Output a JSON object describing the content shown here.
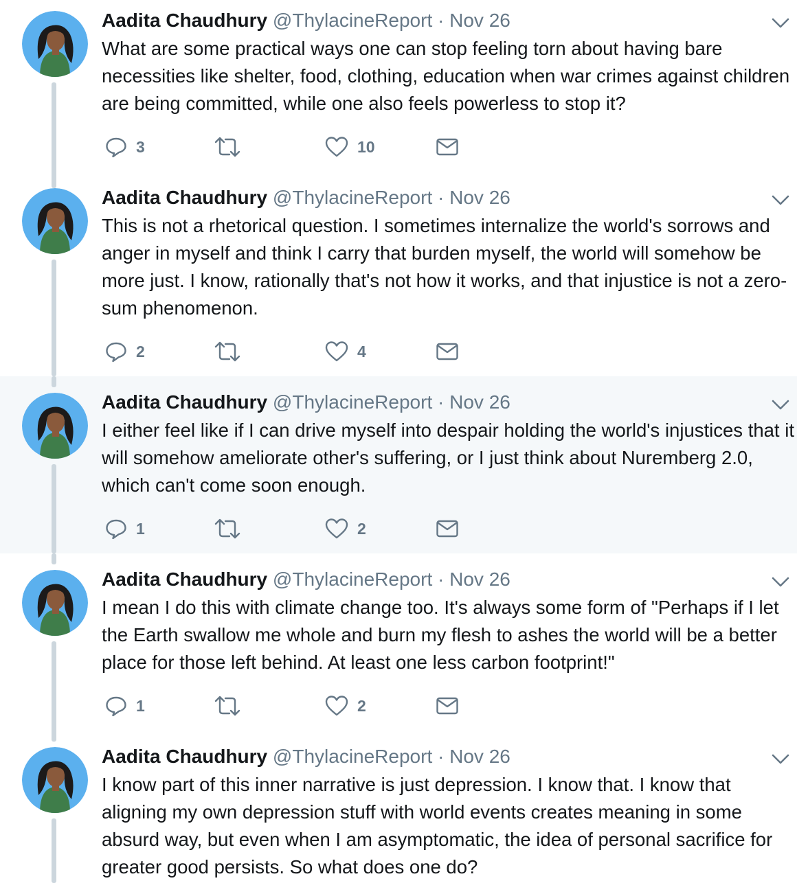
{
  "colors": {
    "text": "#14171a",
    "secondary": "#657786",
    "thread_line": "#ccd6dd",
    "highlight_bg": "#f5f8fa",
    "avatar_bg": "#5bb0ee"
  },
  "tweets": [
    {
      "name": "Aadita Chaudhury",
      "handle": "@ThylacineReport",
      "date": "· Nov 26",
      "text": "What are some practical ways one can stop feeling torn about having bare necessities like shelter, food, clothing, education when war crimes against children are being committed, while one also feels powerless to stop it?",
      "replies": "3",
      "retweets": "",
      "likes": "10",
      "highlighted": false,
      "icons": [
        "avatar",
        "chevron-down-icon",
        "reply-icon",
        "retweet-icon",
        "heart-icon",
        "mail-icon"
      ]
    },
    {
      "name": "Aadita Chaudhury",
      "handle": "@ThylacineReport",
      "date": "· Nov 26",
      "text": "This is not a rhetorical question. I sometimes internalize the world's sorrows and anger in myself and think I carry that burden myself, the world will somehow be more just. I know, rationally that's not how it works, and that injustice is not a zero-sum phenomenon.",
      "replies": "2",
      "retweets": "",
      "likes": "4",
      "highlighted": false,
      "icons": [
        "avatar",
        "chevron-down-icon",
        "reply-icon",
        "retweet-icon",
        "heart-icon",
        "mail-icon"
      ]
    },
    {
      "name": "Aadita Chaudhury",
      "handle": "@ThylacineReport",
      "date": "· Nov 26",
      "text": "I either feel like if I can drive myself into despair holding the world's injustices that it will somehow ameliorate other's suffering, or I just think about Nuremberg 2.0, which can't come soon enough.",
      "replies": "1",
      "retweets": "",
      "likes": "2",
      "highlighted": true,
      "icons": [
        "avatar",
        "chevron-down-icon",
        "reply-icon",
        "retweet-icon",
        "heart-icon",
        "mail-icon"
      ]
    },
    {
      "name": "Aadita Chaudhury",
      "handle": "@ThylacineReport",
      "date": "· Nov 26",
      "text": "I mean I do this with climate change too. It's always some form of \"Perhaps if I let the Earth swallow me whole and burn my flesh to ashes the world will be a better place for those left behind. At least one less carbon footprint!\"",
      "replies": "1",
      "retweets": "",
      "likes": "2",
      "highlighted": false,
      "icons": [
        "avatar",
        "chevron-down-icon",
        "reply-icon",
        "retweet-icon",
        "heart-icon",
        "mail-icon"
      ]
    },
    {
      "name": "Aadita Chaudhury",
      "handle": "@ThylacineReport",
      "date": "· Nov 26",
      "text": "I know part of this inner narrative is just depression. I know that. I know that aligning my own depression stuff with world events creates meaning in some absurd way, but even when I am asymptomatic, the idea of personal sacrifice for greater good persists. So what does one do?",
      "replies": "",
      "retweets": "",
      "likes": "",
      "highlighted": false,
      "icons": [
        "avatar",
        "chevron-down-icon"
      ]
    }
  ]
}
